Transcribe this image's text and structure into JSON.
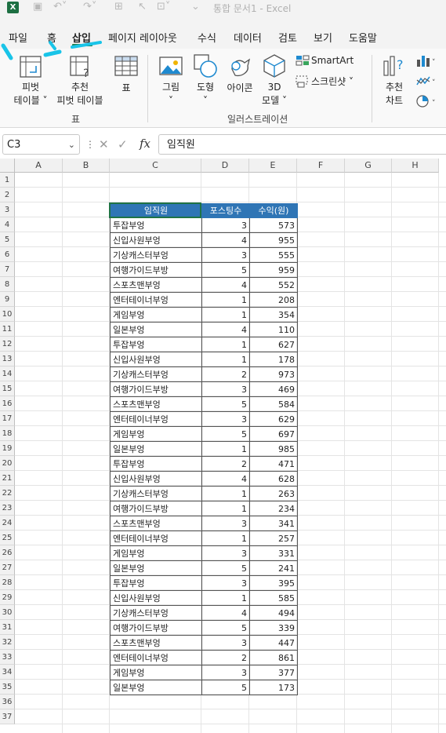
{
  "titlebar": {
    "logo_letter": "X",
    "document_title": "통합 문서1  -  Excel"
  },
  "menu": {
    "items": [
      "파일",
      "홈",
      "삽입",
      "페이지 레이아웃",
      "수식",
      "데이터",
      "검토",
      "보기",
      "도움말"
    ],
    "active": "삽입"
  },
  "ribbon": {
    "pivot_table": [
      "피벗",
      "테이블 ˅"
    ],
    "recommended_pivot": [
      "추천",
      "피벗 테이블"
    ],
    "table": "표",
    "group_tables": "표",
    "picture": [
      "그림",
      "˅"
    ],
    "shapes": [
      "도형",
      "˅"
    ],
    "icons": "아이콘",
    "model_3d": [
      "3D",
      "모델 ˅"
    ],
    "smartart": "SmartArt",
    "screenshot": "스크린샷 ˅",
    "group_illustrations": "일러스트레이션",
    "recommended_charts": [
      "추천",
      "차트"
    ]
  },
  "formula_bar": {
    "name_box": "C3",
    "fx": "fx",
    "content": "임직원"
  },
  "sheet": {
    "columns": [
      "A",
      "B",
      "C",
      "D",
      "E",
      "F",
      "G",
      "H"
    ],
    "rows": [
      "1",
      "2",
      "3",
      "4",
      "5",
      "6",
      "7",
      "8",
      "9",
      "10",
      "11",
      "12",
      "13",
      "14",
      "15",
      "16",
      "17",
      "18",
      "19",
      "20",
      "21",
      "22",
      "23",
      "24",
      "25",
      "26",
      "27",
      "28",
      "29",
      "30",
      "31",
      "32",
      "33",
      "34",
      "35",
      "36",
      "37"
    ],
    "table_header": [
      "임직원",
      "포스팅수",
      "수익(원)"
    ],
    "table_rows": [
      [
        "투잡부엉",
        "3",
        "573"
      ],
      [
        "신입사원부엉",
        "4",
        "955"
      ],
      [
        "기상캐스터부엉",
        "3",
        "555"
      ],
      [
        "여행가이드부방",
        "5",
        "959"
      ],
      [
        "스포츠맨부엉",
        "4",
        "552"
      ],
      [
        "엔터테이너부엉",
        "1",
        "208"
      ],
      [
        "게임부엉",
        "1",
        "354"
      ],
      [
        "일본부엉",
        "4",
        "110"
      ],
      [
        "투잡부엉",
        "1",
        "627"
      ],
      [
        "신입사원부엉",
        "1",
        "178"
      ],
      [
        "기상캐스터부엉",
        "2",
        "973"
      ],
      [
        "여행가이드부방",
        "3",
        "469"
      ],
      [
        "스포츠맨부엉",
        "5",
        "584"
      ],
      [
        "엔터테이너부엉",
        "3",
        "629"
      ],
      [
        "게임부엉",
        "5",
        "697"
      ],
      [
        "일본부엉",
        "1",
        "985"
      ],
      [
        "투잡부엉",
        "2",
        "471"
      ],
      [
        "신입사원부엉",
        "4",
        "628"
      ],
      [
        "기상캐스터부엉",
        "1",
        "263"
      ],
      [
        "여행가이드부방",
        "1",
        "234"
      ],
      [
        "스포츠맨부엉",
        "3",
        "341"
      ],
      [
        "엔터테이너부엉",
        "1",
        "257"
      ],
      [
        "게임부엉",
        "3",
        "331"
      ],
      [
        "일본부엉",
        "5",
        "241"
      ],
      [
        "투잡부엉",
        "3",
        "395"
      ],
      [
        "신입사원부엉",
        "1",
        "585"
      ],
      [
        "기상캐스터부엉",
        "4",
        "494"
      ],
      [
        "여행가이드부방",
        "5",
        "339"
      ],
      [
        "스포츠맨부엉",
        "3",
        "447"
      ],
      [
        "엔터테이너부엉",
        "2",
        "861"
      ],
      [
        "게임부엉",
        "3",
        "377"
      ],
      [
        "일본부엉",
        "5",
        "173"
      ]
    ]
  },
  "colors": {
    "header_fill": "#2f75b5",
    "excel_green": "#1d6f42",
    "annotation_cyan": "#19c4e8"
  }
}
